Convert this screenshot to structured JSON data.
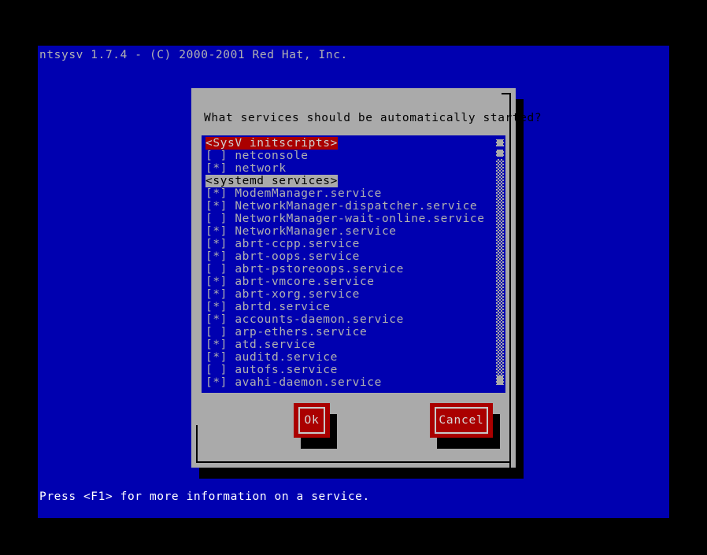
{
  "terminal": {
    "header": "ntsysv 1.7.4 - (C) 2000-2001 Red Hat, Inc.",
    "status": "Press <F1> for more information on a service.",
    "background_color": "#0000b0",
    "text_color": "#b0b0b0"
  },
  "dialog": {
    "prompt": "What services should be automatically started?",
    "background_color": "#aaaaaa",
    "accent_color": "#aa0000"
  },
  "list": {
    "items": [
      {
        "type": "section",
        "checkbox": "",
        "label": "<SysV initscripts>",
        "selected": true
      },
      {
        "type": "item",
        "checkbox": "[ ]",
        "label": "netconsole",
        "selected": false
      },
      {
        "type": "item",
        "checkbox": "[*]",
        "label": "network",
        "selected": false
      },
      {
        "type": "section",
        "checkbox": "",
        "label": "<systemd services>",
        "selected": false
      },
      {
        "type": "item",
        "checkbox": "[*]",
        "label": "ModemManager.service",
        "selected": false
      },
      {
        "type": "item",
        "checkbox": "[*]",
        "label": "NetworkManager-dispatcher.service",
        "selected": false
      },
      {
        "type": "item",
        "checkbox": "[ ]",
        "label": "NetworkManager-wait-online.service",
        "selected": false
      },
      {
        "type": "item",
        "checkbox": "[*]",
        "label": "NetworkManager.service",
        "selected": false
      },
      {
        "type": "item",
        "checkbox": "[*]",
        "label": "abrt-ccpp.service",
        "selected": false
      },
      {
        "type": "item",
        "checkbox": "[*]",
        "label": "abrt-oops.service",
        "selected": false
      },
      {
        "type": "item",
        "checkbox": "[ ]",
        "label": "abrt-pstoreoops.service",
        "selected": false
      },
      {
        "type": "item",
        "checkbox": "[*]",
        "label": "abrt-vmcore.service",
        "selected": false
      },
      {
        "type": "item",
        "checkbox": "[*]",
        "label": "abrt-xorg.service",
        "selected": false
      },
      {
        "type": "item",
        "checkbox": "[*]",
        "label": "abrtd.service",
        "selected": false
      },
      {
        "type": "item",
        "checkbox": "[*]",
        "label": "accounts-daemon.service",
        "selected": false
      },
      {
        "type": "item",
        "checkbox": "[ ]",
        "label": "arp-ethers.service",
        "selected": false
      },
      {
        "type": "item",
        "checkbox": "[*]",
        "label": "atd.service",
        "selected": false
      },
      {
        "type": "item",
        "checkbox": "[*]",
        "label": "auditd.service",
        "selected": false
      },
      {
        "type": "item",
        "checkbox": "[ ]",
        "label": "autofs.service",
        "selected": false
      },
      {
        "type": "item",
        "checkbox": "[*]",
        "label": "avahi-daemon.service",
        "selected": false
      }
    ]
  },
  "scrollbar": {
    "orientation": "vertical",
    "position": "top"
  },
  "buttons": {
    "ok": "Ok",
    "cancel": "Cancel"
  }
}
